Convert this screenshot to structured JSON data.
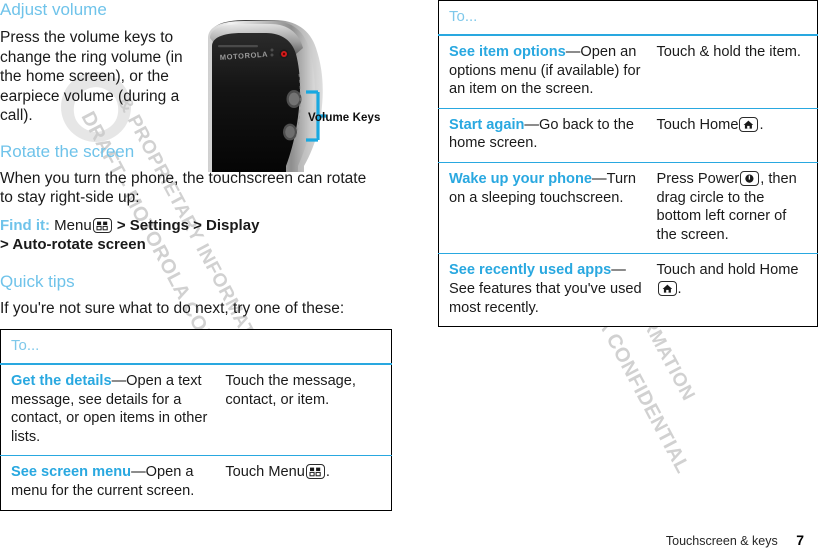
{
  "document": {
    "watermark": "DRAFT - MOTOROLA CONFIDENTIAL & PROPRIETARY INFORMATION",
    "watermark_line1": "DRAFT - MOTOROLA CONFIDENTIAL",
    "watermark_line2": "& PROPRIETARY INFORMATION",
    "accent_color": "#29a8e0",
    "heading_color": "#6fc3ea"
  },
  "left_column": {
    "adjust_volume": {
      "heading": "Adjust volume",
      "body": "Press the volume keys to change the ring volume (in the home screen), or the earpiece volume (during a call)."
    },
    "figure": {
      "caption": "Volume Keys",
      "brand": "MOTOROLA"
    },
    "rotate_screen": {
      "heading": "Rotate the screen",
      "body": "When you turn the phone, the touchscreen can rotate to stay right-side up:",
      "findit_label": "Find it:",
      "findit_pre": "Menu",
      "findit_path_1": "> Settings > Display",
      "findit_path_2": "> Auto-rotate screen"
    },
    "quick_tips": {
      "heading": "Quick tips",
      "body": "If you're not sure what to do next, try one of these:"
    },
    "table": {
      "header": "To...",
      "rows": [
        {
          "term": "Get the details",
          "desc": "—Open a text message, see details for a contact, or open items in other lists.",
          "action_pre": "Touch the message, contact, or item.",
          "action_icon": "",
          "action_post": ""
        },
        {
          "term": "See screen menu",
          "desc": "—Open a menu for the current screen.",
          "action_pre": "Touch Menu",
          "action_icon": "menu-icon",
          "action_post": "."
        }
      ]
    }
  },
  "right_column": {
    "table": {
      "header": "To...",
      "rows": [
        {
          "term": "See item options",
          "desc": "—Open an options menu (if available) for an item on the screen.",
          "action_pre": "Touch & hold the item.",
          "action_icon": "",
          "action_post": ""
        },
        {
          "term": "Start again",
          "desc": "—Go back to the home screen.",
          "action_pre": "Touch Home",
          "action_icon": "home-icon",
          "action_post": "."
        },
        {
          "term": "Wake up your phone",
          "desc": "—Turn on a sleeping touchscreen.",
          "action_pre": "Press Power",
          "action_icon": "power-icon",
          "action_post": ", then drag circle to the bottom left corner of the screen."
        },
        {
          "term": "See recently used apps",
          "desc": "—See features that you've used most recently.",
          "action_pre": "Touch and hold Home",
          "action_icon": "home-icon",
          "action_post": "."
        }
      ]
    }
  },
  "footer": {
    "title": "Touchscreen & keys",
    "page": "7"
  }
}
